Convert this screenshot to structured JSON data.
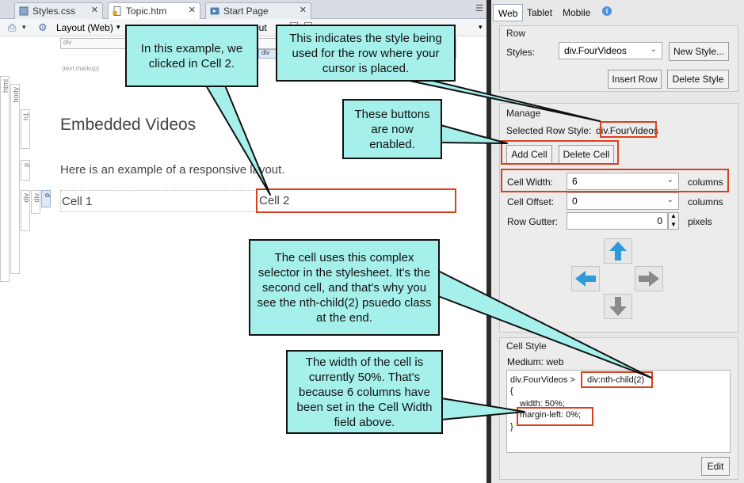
{
  "tabs": [
    {
      "label": "Styles.css",
      "icon": "css-file-icon"
    },
    {
      "label": "Topic.htm",
      "icon": "htm-file-icon"
    },
    {
      "label": "Start Page",
      "icon": "start-page-icon"
    }
  ],
  "toolbar": {
    "layout_label": "Layout (Web)",
    "out_fragment": "out"
  },
  "editor": {
    "structure_div_label": "div",
    "structure_div2_label": "div",
    "text_markup_label": "(text markup)",
    "bar_labels": [
      "html",
      "body",
      "h1",
      "p",
      "div",
      "div",
      "p"
    ],
    "heading": "Embedded Videos",
    "paragraph": "Here is an example of a responsive layout.",
    "cell1": "Cell 1",
    "cell2": "Cell 2"
  },
  "panel": {
    "tabs": [
      "Web",
      "Tablet",
      "Mobile"
    ],
    "row": {
      "title": "Row",
      "styles_label": "Styles:",
      "styles_value": "div.FourVideos",
      "new_style_button": "New Style...",
      "insert_row_button": "Insert Row",
      "delete_style_button": "Delete Style"
    },
    "manage": {
      "title": "Manage",
      "selected_row_style_label": "Selected Row Style:",
      "selected_row_style_value": "div.FourVideos",
      "add_cell_button": "Add Cell",
      "delete_cell_button": "Delete Cell",
      "cell_width_label": "Cell Width:",
      "cell_width_value": "6",
      "cell_width_unit": "columns",
      "cell_offset_label": "Cell Offset:",
      "cell_offset_value": "0",
      "cell_offset_unit": "columns",
      "row_gutter_label": "Row Gutter:",
      "row_gutter_value": "0",
      "row_gutter_unit": "pixels"
    },
    "cell_style": {
      "title": "Cell Style",
      "medium_label": "Medium: web",
      "code_selector_prefix": "div.FourVideos >",
      "code_selector_suffix": "div:nth-child(2)",
      "code_open": "{",
      "code_width": "width: 50%;",
      "code_margin": "margin-left: 0%;",
      "code_close": "}",
      "edit_button": "Edit"
    }
  },
  "callouts": {
    "clicked": "In this example, we clicked in Cell 2.",
    "row_style": "This indicates the style being used for the row where your cursor is placed.",
    "buttons": "These buttons are now enabled.",
    "selector": "The cell uses this complex selector in the stylesheet. It's the second cell, and that's why you see the nth-child(2) psuedo class at the end.",
    "width": "The width of the cell is currently 50%. That's because 6 columns have been set in the Cell Width field above."
  },
  "colors": {
    "callout_fill": "#a6f0ec",
    "highlight_red": "#d9411e",
    "arrow_blue": "#2f9ad6",
    "arrow_gray": "#8a8a8a"
  }
}
